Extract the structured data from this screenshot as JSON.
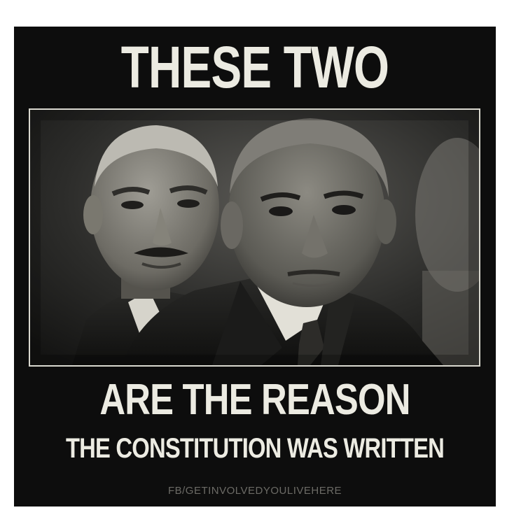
{
  "poster": {
    "headline_top": "THESE TWO",
    "headline_mid": "ARE THE REASON",
    "headline_bottom": "THE CONSTITUTION WAS WRITTEN",
    "watermark": "FB/GETINVOLVEDYOULIVEHERE"
  },
  "photo": {
    "subject_left": "man-with-mustache-portrait",
    "subject_right": "man-in-suit-portrait",
    "tone": "monochrome"
  },
  "colors": {
    "background": "#0d0d0d",
    "text": "#ecebe2",
    "watermark": "#6c6b66",
    "frame": "#d9d8cf"
  }
}
